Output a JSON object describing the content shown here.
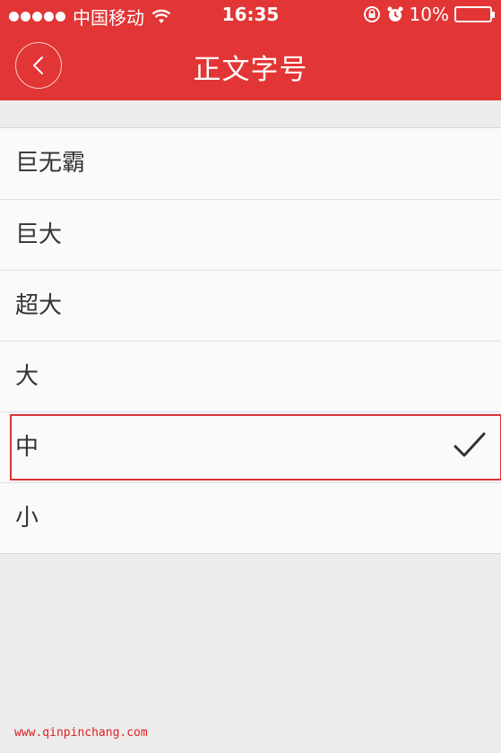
{
  "status_bar": {
    "carrier": "中国移动",
    "time": "16:35",
    "battery": "10%",
    "icons": [
      "signal-dots-icon",
      "wifi-icon",
      "rotation-lock-icon",
      "alarm-icon",
      "battery-icon"
    ]
  },
  "header": {
    "title": "正文字号",
    "back_icon": "chevron-left-icon",
    "background": "#e23535"
  },
  "font_sizes": {
    "items": [
      {
        "label": "巨无霸"
      },
      {
        "label": "巨大"
      },
      {
        "label": "超大"
      },
      {
        "label": "大"
      },
      {
        "label": "中",
        "selected": true
      },
      {
        "label": "小"
      }
    ]
  },
  "watermark": "www.qinpinchang.com",
  "colors": {
    "accent": "#e23535",
    "highlight_box": "#d9343a",
    "watermark": "#e02020"
  }
}
